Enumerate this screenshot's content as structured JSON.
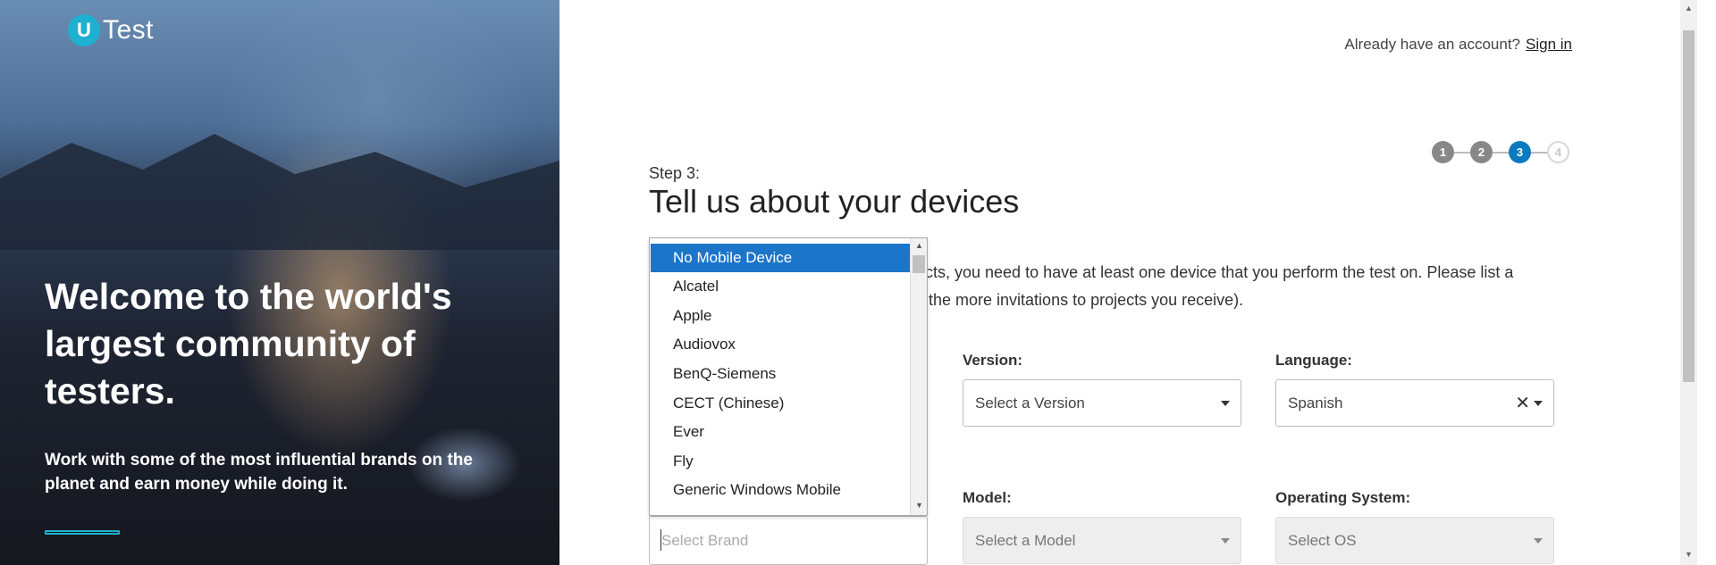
{
  "brand": {
    "logo_mark": "U",
    "logo_text": "Test"
  },
  "hero": {
    "title": "Welcome to the world's largest community of testers.",
    "subtitle": "Work with some of the most influential brands on the planet and earn money while doing it."
  },
  "header": {
    "already_text": "Already have an account?",
    "sign_in": "Sign in"
  },
  "stepper": {
    "steps": [
      "1",
      "2",
      "3",
      "4"
    ],
    "current": 3
  },
  "page": {
    "step_label": "Step 3:",
    "title": "Tell us about your devices",
    "intro_line1": "cts, you need to have at least one device that you perform the test on. Please list a",
    "intro_line2": "the more invitations to projects you receive)."
  },
  "fields": {
    "version": {
      "label": "Version:",
      "value": "Select a Version"
    },
    "language": {
      "label": "Language:",
      "value": "Spanish"
    },
    "model": {
      "label": "Model:",
      "value": "Select a Model"
    },
    "os": {
      "label": "Operating System:",
      "value": "Select OS"
    },
    "brand": {
      "placeholder": "Select Brand"
    }
  },
  "brand_dropdown": {
    "options": [
      "No Mobile Device",
      "Alcatel",
      "Apple",
      "Audiovox",
      "BenQ-Siemens",
      "CECT (Chinese)",
      "Ever",
      "Fly",
      "Generic Windows Mobile"
    ],
    "selected": "No Mobile Device"
  },
  "icons": {
    "clear": "close-icon",
    "caret": "chevron-down-icon"
  },
  "colors": {
    "accent": "#0b79bf",
    "logo": "#1eb0d0",
    "selected_option": "#1b75c9"
  }
}
